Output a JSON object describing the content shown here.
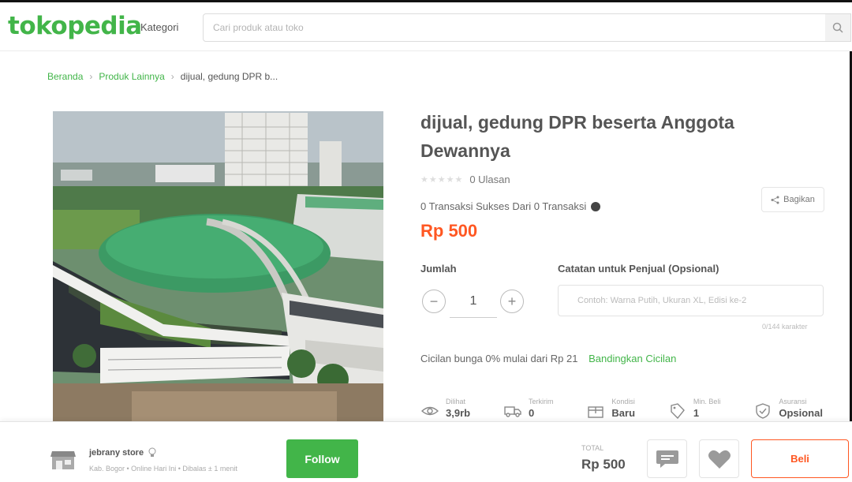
{
  "header": {
    "logo": "tokopedia",
    "kategori": "Kategori",
    "search_placeholder": "Cari produk atau toko"
  },
  "breadcrumb": {
    "items": [
      "Beranda",
      "Produk Lainnya",
      "dijual, gedung DPR b..."
    ]
  },
  "product": {
    "title": "dijual, gedung DPR beserta Anggota Dewannya",
    "rating_stars": 0,
    "reviews": "0 Ulasan",
    "share": "Bagikan",
    "transaksi": "0 Transaksi Sukses Dari  0 Transaksi",
    "price": "Rp 500"
  },
  "order": {
    "jumlah_label": "Jumlah",
    "quantity": "1",
    "catatan_label": "Catatan untuk Penjual (Opsional)",
    "catatan_placeholder": "Contoh: Warna Putih, Ukuran XL, Edisi ke-2",
    "char_count": "0/144 karakter"
  },
  "cicilan": {
    "text": "Cicilan bunga 0% mulai dari Rp 21",
    "link": "Bandingkan Cicilan"
  },
  "stats": [
    {
      "icon": "eye-icon",
      "label": "Dilihat",
      "value": "3,9rb"
    },
    {
      "icon": "truck-icon",
      "label": "Terkirim",
      "value": "0"
    },
    {
      "icon": "box-icon",
      "label": "Kondisi",
      "value": "Baru"
    },
    {
      "icon": "tag-icon",
      "label": "Min. Beli",
      "value": "1"
    },
    {
      "icon": "shield-icon",
      "label": "Asuransi",
      "value": "Opsional"
    }
  ],
  "bottom_bar": {
    "store_name": "jebrany store",
    "store_meta": "Kab. Bogor • Online Hari Ini • Dibalas ± 1 menit",
    "follow": "Follow",
    "total_label": "TOTAL",
    "total_value": "Rp 500",
    "beli": "Beli"
  },
  "colors": {
    "brand_green": "#42b549",
    "price_orange": "#ff5722"
  }
}
